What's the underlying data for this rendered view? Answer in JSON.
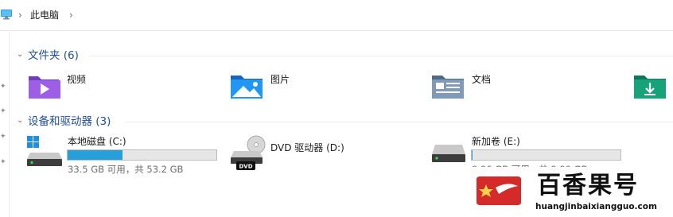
{
  "breadcrumb": {
    "location": "此电脑"
  },
  "folders_section": {
    "title": "文件夹 (6)"
  },
  "folders": [
    {
      "label": "视频",
      "icon": "videos-folder-icon"
    },
    {
      "label": "图片",
      "icon": "pictures-folder-icon"
    },
    {
      "label": "文档",
      "icon": "documents-folder-icon"
    },
    {
      "label": "",
      "icon": "downloads-folder-icon"
    }
  ],
  "drives_section": {
    "title": "设备和驱动器 (3)"
  },
  "drives": [
    {
      "label": "本地磁盘 (C:)",
      "free": "33.5 GB 可用，共 53.2 GB",
      "used_fraction": 0.37,
      "icon": "windows-drive-icon"
    },
    {
      "label": "DVD 驱动器 (D:)",
      "icon": "dvd-drive-icon"
    },
    {
      "label": "新加卷 (E:)",
      "free": "9.96 GB 可用，共 9.99 GB",
      "used_fraction": 0.003,
      "icon": "hard-drive-icon"
    }
  ],
  "watermark": {
    "title": "百香果号",
    "url": "huangjinbaixiangguo.com"
  },
  "colors": {
    "accent": "#26a0da",
    "section_title": "#1f4f94"
  }
}
